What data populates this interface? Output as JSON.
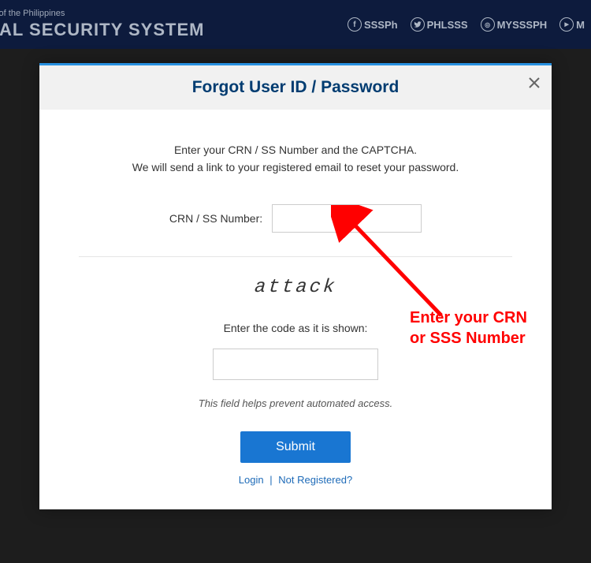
{
  "header": {
    "subtitle": "c of the Philippines",
    "title": "CIAL SECURITY SYSTEM",
    "social": [
      {
        "icon": "f",
        "label": "SSSPh"
      },
      {
        "icon": "t",
        "label": "PHLSSS"
      },
      {
        "icon": "ig",
        "label": "MYSSSPH"
      },
      {
        "icon": "yt",
        "label": "M"
      }
    ]
  },
  "modal": {
    "title": "Forgot User ID / Password",
    "instructions_line1": "Enter your CRN / SS Number and the CAPTCHA.",
    "instructions_line2": "We will send a link to your registered email to reset your password.",
    "crn_label": "CRN / SS Number:",
    "captcha_text": "attack",
    "captcha_label": "Enter the code as it is shown:",
    "help_text": "This field helps prevent automated access.",
    "submit_label": "Submit",
    "login_link": "Login",
    "link_sep": "|",
    "register_link": "Not Registered?"
  },
  "annotation": {
    "text_line1": "Enter your CRN",
    "text_line2": "or SSS Number"
  }
}
